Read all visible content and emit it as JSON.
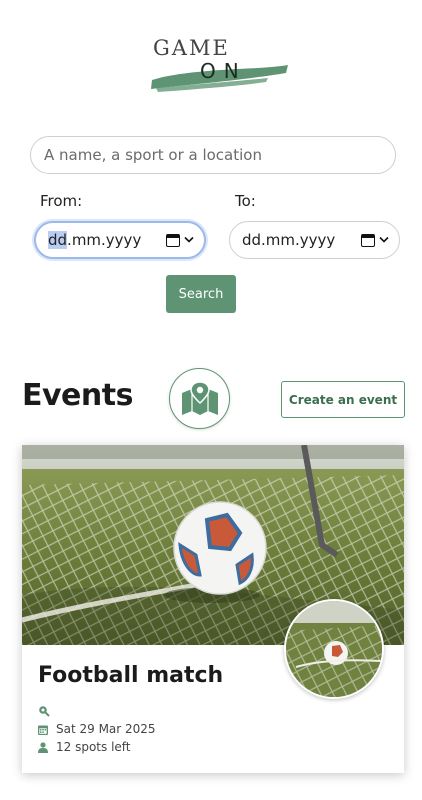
{
  "logo": {
    "line1": "GAME",
    "line2": "ON",
    "accent": "#5e9473"
  },
  "search": {
    "placeholder": "A name, a sport or a location",
    "button_label": "Search"
  },
  "filters": {
    "from_label": "From:",
    "to_label": "To:",
    "from_value_highlight": "dd",
    "from_value_rest": ".mm.yyyy",
    "to_value": "dd.mm.yyyy"
  },
  "events": {
    "title": "Events",
    "create_label": "Create an event",
    "map_icon": "map-pin-icon",
    "items": [
      {
        "title": "Football match",
        "location": "",
        "date": "Sat 29 Mar 2025",
        "spots": "12 spots left"
      }
    ]
  },
  "colors": {
    "primary": "#5e9473",
    "focus": "#9db8ea"
  }
}
